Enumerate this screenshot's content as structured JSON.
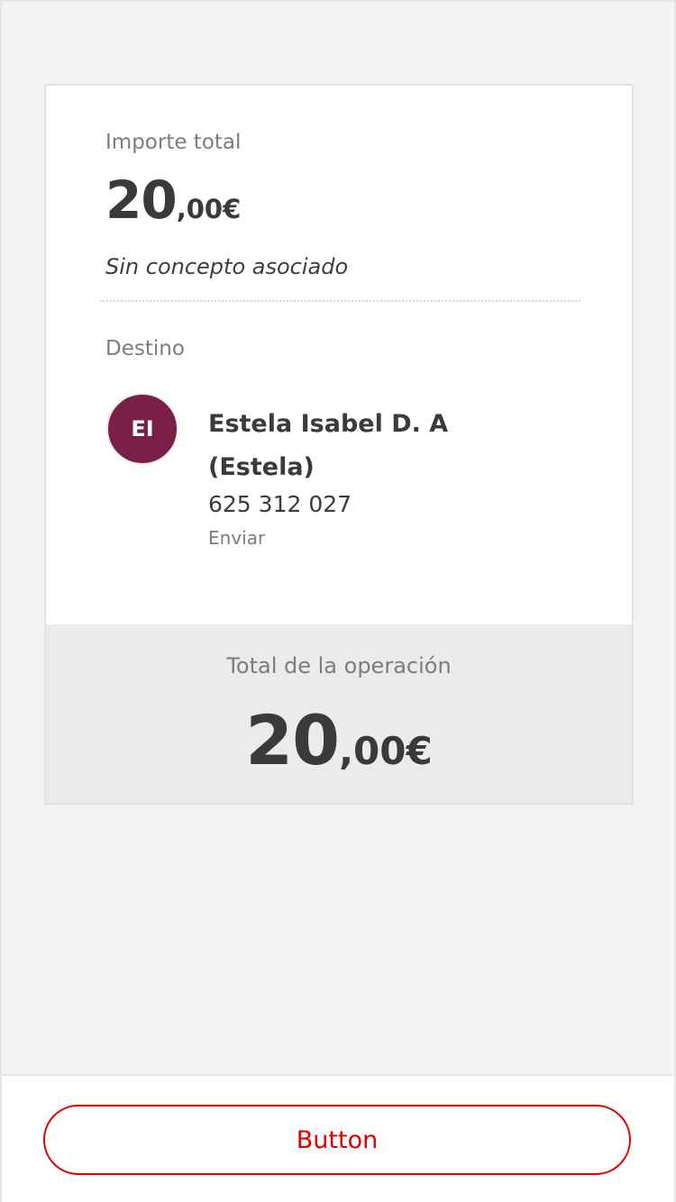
{
  "summary": {
    "amount_label": "Importe total",
    "amount": {
      "integer": "20",
      "decimal": ",00",
      "currency": "€"
    },
    "concept": "Sin concepto asociado"
  },
  "destination": {
    "label": "Destino",
    "avatar_initials": "EI",
    "avatar_color": "#7a1f47",
    "name": "Estela Isabel D. A (Estela)",
    "phone": "625 312 027",
    "action": "Enviar"
  },
  "total": {
    "label": "Total de la operación",
    "amount": {
      "integer": "20",
      "decimal": ",00",
      "currency": "€"
    }
  },
  "footer": {
    "button_label": "Button",
    "accent_color": "#e00000"
  }
}
